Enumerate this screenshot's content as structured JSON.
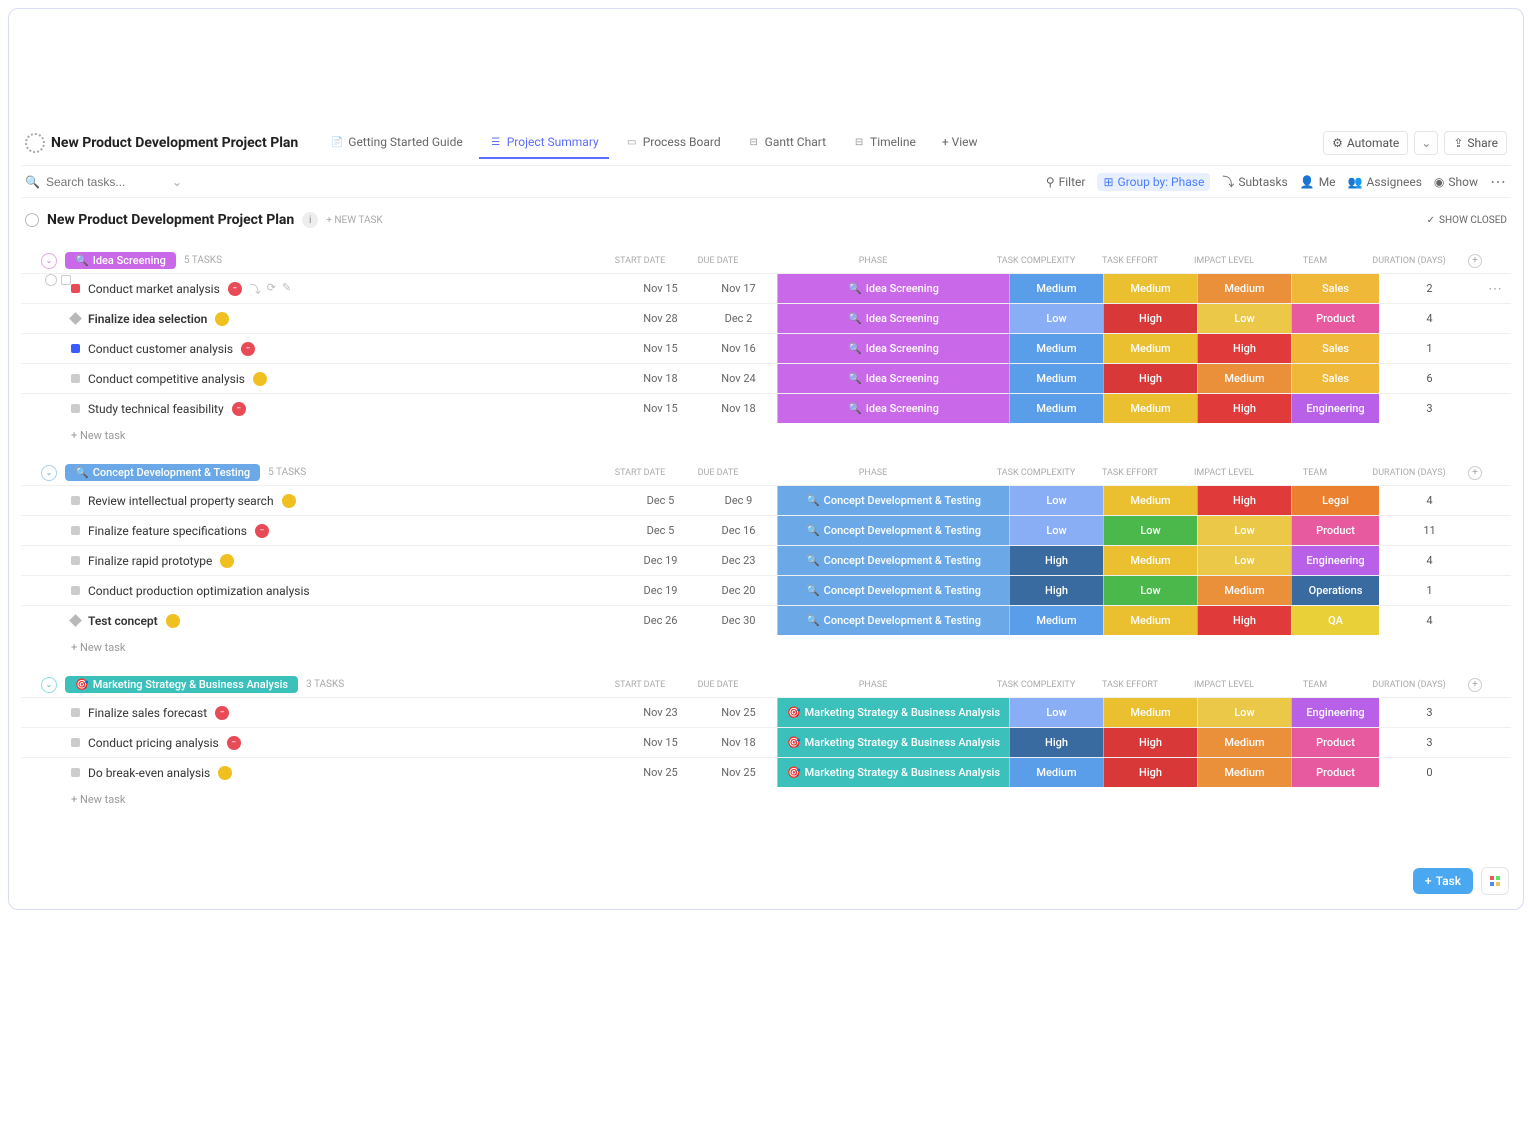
{
  "header": {
    "project_title": "New Product Development Project Plan",
    "tabs": [
      {
        "label": "Getting Started Guide",
        "icon": "📄"
      },
      {
        "label": "Project Summary",
        "icon": "☰",
        "active": true
      },
      {
        "label": "Process Board",
        "icon": "▭"
      },
      {
        "label": "Gantt Chart",
        "icon": "⊟"
      },
      {
        "label": "Timeline",
        "icon": "⊟"
      }
    ],
    "add_view": "+ View",
    "automate": "Automate",
    "share": "Share"
  },
  "toolbar": {
    "search_placeholder": "Search tasks...",
    "filter": "Filter",
    "group_by": "Group by: Phase",
    "subtasks": "Subtasks",
    "me": "Me",
    "assignees": "Assignees",
    "show": "Show"
  },
  "list_header": {
    "title": "New Product Development Project Plan",
    "new_task": "+ NEW TASK",
    "show_closed": "SHOW CLOSED"
  },
  "columns": {
    "start": "START DATE",
    "due": "DUE DATE",
    "phase": "PHASE",
    "complexity": "TASK COMPLEXITY",
    "effort": "TASK EFFORT",
    "impact": "IMPACT LEVEL",
    "team": "TEAM",
    "duration": "DURATION (DAYS)"
  },
  "groups": [
    {
      "name": "Idea Screening",
      "pill_class": "pill-1",
      "collapse_class": "collapse-1",
      "phase_bg": "bg-phase1",
      "icon": "🔍",
      "task_count": "5 TASKS",
      "tasks": [
        {
          "name": "Conduct market analysis",
          "prio": "prio-red prio-sq",
          "status": "sd-red",
          "status_sym": "−",
          "start": "Nov 15",
          "due": "Nov 17",
          "complexity": "Medium",
          "cplx_bg": "bg-med-blue",
          "effort": "Medium",
          "eff_bg": "bg-med-yellow",
          "impact": "Medium",
          "imp_bg": "bg-med-orange",
          "team": "Sales",
          "team_bg": "bg-sales",
          "duration": "2",
          "hover": true,
          "checks": true,
          "actions": true
        },
        {
          "name": "Finalize idea selection",
          "bold": true,
          "prio": "prio-dgray prio-diamond",
          "status": "sd-yellow",
          "status_sym": "",
          "start": "Nov 28",
          "due": "Dec 2",
          "complexity": "Low",
          "cplx_bg": "bg-low-blue",
          "effort": "High",
          "eff_bg": "bg-high-red",
          "impact": "Low",
          "imp_bg": "bg-low-yellow",
          "team": "Product",
          "team_bg": "bg-product",
          "duration": "4"
        },
        {
          "name": "Conduct customer analysis",
          "prio": "prio-blue prio-sq",
          "status": "sd-red",
          "status_sym": "−",
          "start": "Nov 15",
          "due": "Nov 16",
          "complexity": "Medium",
          "cplx_bg": "bg-med-blue",
          "effort": "Medium",
          "eff_bg": "bg-med-yellow",
          "impact": "High",
          "imp_bg": "bg-high-red2",
          "team": "Sales",
          "team_bg": "bg-sales",
          "duration": "1"
        },
        {
          "name": "Conduct competitive analysis",
          "prio": "prio-gray prio-sq",
          "status": "sd-yellow",
          "status_sym": "",
          "start": "Nov 18",
          "due": "Nov 24",
          "complexity": "Medium",
          "cplx_bg": "bg-med-blue",
          "effort": "High",
          "eff_bg": "bg-high-red",
          "impact": "Medium",
          "imp_bg": "bg-med-orange",
          "team": "Sales",
          "team_bg": "bg-sales",
          "duration": "6"
        },
        {
          "name": "Study technical feasibility",
          "prio": "prio-gray prio-sq",
          "status": "sd-red",
          "status_sym": "−",
          "start": "Nov 15",
          "due": "Nov 18",
          "complexity": "Medium",
          "cplx_bg": "bg-med-blue",
          "effort": "Medium",
          "eff_bg": "bg-med-yellow",
          "impact": "High",
          "imp_bg": "bg-high-red2",
          "team": "Engineering",
          "team_bg": "bg-engineering",
          "duration": "3"
        }
      ]
    },
    {
      "name": "Concept Development & Testing",
      "pill_class": "pill-2",
      "collapse_class": "collapse-2",
      "phase_bg": "bg-phase2",
      "icon": "🔍",
      "task_count": "5 TASKS",
      "tasks": [
        {
          "name": "Review intellectual property search",
          "prio": "prio-gray prio-sq",
          "status": "sd-yellow",
          "status_sym": "",
          "start": "Dec 5",
          "due": "Dec 9",
          "complexity": "Low",
          "cplx_bg": "bg-low-blue",
          "effort": "Medium",
          "eff_bg": "bg-med-yellow",
          "impact": "High",
          "imp_bg": "bg-high-red2",
          "team": "Legal",
          "team_bg": "bg-legal",
          "duration": "4"
        },
        {
          "name": "Finalize feature specifications",
          "prio": "prio-gray prio-sq",
          "status": "sd-red",
          "status_sym": "−",
          "start": "Dec 5",
          "due": "Dec 16",
          "complexity": "Low",
          "cplx_bg": "bg-low-blue",
          "effort": "Low",
          "eff_bg": "bg-low-green",
          "impact": "Low",
          "imp_bg": "bg-low-yellow",
          "team": "Product",
          "team_bg": "bg-product",
          "duration": "11"
        },
        {
          "name": "Finalize rapid prototype",
          "prio": "prio-gray prio-sq",
          "status": "sd-yellow",
          "status_sym": "",
          "start": "Dec 19",
          "due": "Dec 23",
          "complexity": "High",
          "cplx_bg": "bg-high-blue",
          "effort": "Medium",
          "eff_bg": "bg-med-yellow",
          "impact": "Low",
          "imp_bg": "bg-low-yellow",
          "team": "Engineering",
          "team_bg": "bg-engineering",
          "duration": "4"
        },
        {
          "name": "Conduct production optimization analysis",
          "prio": "prio-gray prio-sq",
          "status": "",
          "status_sym": "",
          "start": "Dec 19",
          "due": "Dec 20",
          "complexity": "High",
          "cplx_bg": "bg-high-blue",
          "effort": "Low",
          "eff_bg": "bg-low-green",
          "impact": "Medium",
          "imp_bg": "bg-med-orange",
          "team": "Operations",
          "team_bg": "bg-operations",
          "duration": "1"
        },
        {
          "name": "Test concept",
          "bold": true,
          "prio": "prio-dgray prio-diamond",
          "status": "sd-yellow",
          "status_sym": "",
          "start": "Dec 26",
          "due": "Dec 30",
          "complexity": "Medium",
          "cplx_bg": "bg-med-blue",
          "effort": "Medium",
          "eff_bg": "bg-med-yellow",
          "impact": "High",
          "imp_bg": "bg-high-red2",
          "team": "QA",
          "team_bg": "bg-qa",
          "duration": "4"
        }
      ]
    },
    {
      "name": "Marketing Strategy & Business Analysis",
      "pill_class": "pill-3",
      "collapse_class": "collapse-3",
      "phase_bg": "bg-phase3",
      "icon": "🎯",
      "task_count": "3 TASKS",
      "tasks": [
        {
          "name": "Finalize sales forecast",
          "prio": "prio-gray prio-sq",
          "status": "sd-red",
          "status_sym": "−",
          "start": "Nov 23",
          "due": "Nov 25",
          "complexity": "Low",
          "cplx_bg": "bg-low-blue",
          "effort": "Medium",
          "eff_bg": "bg-med-yellow",
          "impact": "Low",
          "imp_bg": "bg-low-yellow",
          "team": "Engineering",
          "team_bg": "bg-engineering",
          "duration": "3"
        },
        {
          "name": "Conduct pricing analysis",
          "prio": "prio-gray prio-sq",
          "status": "sd-red",
          "status_sym": "−",
          "start": "Nov 15",
          "due": "Nov 18",
          "complexity": "High",
          "cplx_bg": "bg-high-blue",
          "effort": "High",
          "eff_bg": "bg-high-red",
          "impact": "Medium",
          "imp_bg": "bg-med-orange",
          "team": "Product",
          "team_bg": "bg-product",
          "duration": "3"
        },
        {
          "name": "Do break-even analysis",
          "prio": "prio-gray prio-sq",
          "status": "sd-yellow",
          "status_sym": "",
          "start": "Nov 25",
          "due": "Nov 25",
          "complexity": "Medium",
          "cplx_bg": "bg-med-blue",
          "effort": "High",
          "eff_bg": "bg-high-red",
          "impact": "Medium",
          "imp_bg": "bg-med-orange",
          "team": "Product",
          "team_bg": "bg-product",
          "duration": "0"
        }
      ]
    }
  ],
  "new_task_label": "+ New task",
  "fab": {
    "task": "Task"
  }
}
